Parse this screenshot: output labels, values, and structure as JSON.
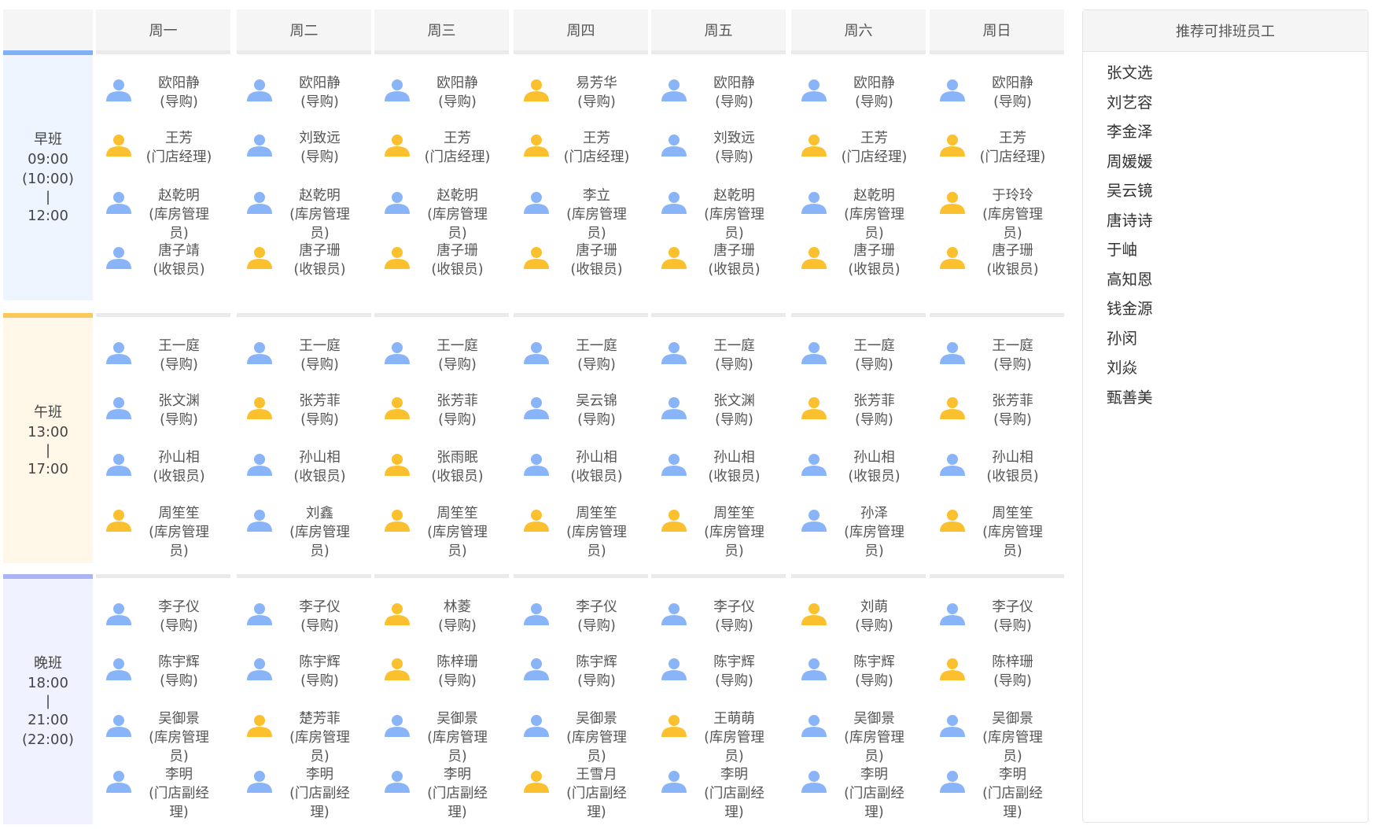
{
  "days": [
    "周一",
    "周二",
    "周三",
    "周四",
    "周五",
    "周六",
    "周日"
  ],
  "colors": {
    "blue": "#8ab4f8",
    "yellow": "#fbc02d",
    "morning_bg": "#eef5ff",
    "noon_bg": "#fff8e8",
    "evening_bg": "#f0f3ff",
    "morning_accent": "#7fb0f5",
    "noon_accent": "#fbc85a",
    "evening_accent": "#aab4f5"
  },
  "shifts": [
    {
      "name": "早班",
      "time_lines": [
        "09:00",
        "(10:00)",
        "|",
        "12:00"
      ],
      "days": [
        [
          {
            "color": "blue",
            "icon": "person-icon",
            "lines": [
              "欧阳静",
              "(导购)"
            ]
          },
          {
            "color": "yellow",
            "icon": "person-icon",
            "lines": [
              "王芳",
              "(门店经理)"
            ]
          },
          {
            "color": "blue",
            "icon": "person-icon",
            "lines": [
              "赵乾明",
              "(库房管理",
              "员)"
            ]
          },
          {
            "color": "blue",
            "icon": "person-icon",
            "lines": [
              "唐子靖",
              "(收银员)"
            ]
          }
        ],
        [
          {
            "color": "blue",
            "icon": "person-icon",
            "lines": [
              "欧阳静",
              "(导购)"
            ]
          },
          {
            "color": "blue",
            "icon": "person-icon",
            "lines": [
              "刘致远",
              "(导购)"
            ]
          },
          {
            "color": "blue",
            "icon": "person-icon",
            "lines": [
              "赵乾明",
              "(库房管理",
              "员)"
            ]
          },
          {
            "color": "yellow",
            "icon": "person-icon",
            "lines": [
              "唐子珊",
              "(收银员)"
            ]
          }
        ],
        [
          {
            "color": "blue",
            "icon": "person-icon",
            "lines": [
              "欧阳静",
              "(导购)"
            ]
          },
          {
            "color": "yellow",
            "icon": "person-icon",
            "lines": [
              "王芳",
              "(门店经理)"
            ]
          },
          {
            "color": "blue",
            "icon": "person-icon",
            "lines": [
              "赵乾明",
              "(库房管理",
              "员)"
            ]
          },
          {
            "color": "yellow",
            "icon": "person-icon",
            "lines": [
              "唐子珊",
              "(收银员)"
            ]
          }
        ],
        [
          {
            "color": "yellow",
            "icon": "person-icon",
            "lines": [
              "易芳华",
              "(导购)"
            ]
          },
          {
            "color": "yellow",
            "icon": "person-icon",
            "lines": [
              "王芳",
              "(门店经理)"
            ]
          },
          {
            "color": "blue",
            "icon": "person-icon",
            "lines": [
              "李立",
              "(库房管理",
              "员)"
            ]
          },
          {
            "color": "yellow",
            "icon": "person-icon",
            "lines": [
              "唐子珊",
              "(收银员)"
            ]
          }
        ],
        [
          {
            "color": "blue",
            "icon": "person-icon",
            "lines": [
              "欧阳静",
              "(导购)"
            ]
          },
          {
            "color": "blue",
            "icon": "person-icon",
            "lines": [
              "刘致远",
              "(导购)"
            ]
          },
          {
            "color": "blue",
            "icon": "person-icon",
            "lines": [
              "赵乾明",
              "(库房管理",
              "员)"
            ]
          },
          {
            "color": "yellow",
            "icon": "person-icon",
            "lines": [
              "唐子珊",
              "(收银员)"
            ]
          }
        ],
        [
          {
            "color": "blue",
            "icon": "person-icon",
            "lines": [
              "欧阳静",
              "(导购)"
            ]
          },
          {
            "color": "yellow",
            "icon": "person-icon",
            "lines": [
              "王芳",
              "(门店经理)"
            ]
          },
          {
            "color": "blue",
            "icon": "person-icon",
            "lines": [
              "赵乾明",
              "(库房管理",
              "员)"
            ]
          },
          {
            "color": "yellow",
            "icon": "person-icon",
            "lines": [
              "唐子珊",
              "(收银员)"
            ]
          }
        ],
        [
          {
            "color": "blue",
            "icon": "person-icon",
            "lines": [
              "欧阳静",
              "(导购)"
            ]
          },
          {
            "color": "yellow",
            "icon": "person-icon",
            "lines": [
              "王芳",
              "(门店经理)"
            ]
          },
          {
            "color": "yellow",
            "icon": "person-icon",
            "lines": [
              "于玲玲",
              "(库房管理",
              "员)"
            ]
          },
          {
            "color": "yellow",
            "icon": "person-icon",
            "lines": [
              "唐子珊",
              "(收银员)"
            ]
          }
        ]
      ]
    },
    {
      "name": "午班",
      "time_lines": [
        "13:00",
        "|",
        "17:00"
      ],
      "days": [
        [
          {
            "color": "blue",
            "icon": "person-icon",
            "lines": [
              "王一庭",
              "(导购)"
            ]
          },
          {
            "color": "blue",
            "icon": "person-icon",
            "lines": [
              "张文渊",
              "(导购)"
            ]
          },
          {
            "color": "blue",
            "icon": "person-icon",
            "lines": [
              "孙山相",
              "(收银员)"
            ]
          },
          {
            "color": "yellow",
            "icon": "person-icon",
            "lines": [
              "周笙笙",
              "(库房管理",
              "员)"
            ]
          }
        ],
        [
          {
            "color": "blue",
            "icon": "person-icon",
            "lines": [
              "王一庭",
              "(导购)"
            ]
          },
          {
            "color": "yellow",
            "icon": "person-icon",
            "lines": [
              "张芳菲",
              "(导购)"
            ]
          },
          {
            "color": "blue",
            "icon": "person-icon",
            "lines": [
              "孙山相",
              "(收银员)"
            ]
          },
          {
            "color": "blue",
            "icon": "person-icon",
            "lines": [
              "刘鑫",
              "(库房管理",
              "员)"
            ]
          }
        ],
        [
          {
            "color": "blue",
            "icon": "person-icon",
            "lines": [
              "王一庭",
              "(导购)"
            ]
          },
          {
            "color": "yellow",
            "icon": "person-icon",
            "lines": [
              "张芳菲",
              "(导购)"
            ]
          },
          {
            "color": "yellow",
            "icon": "person-icon",
            "lines": [
              "张雨眠",
              "(收银员)"
            ]
          },
          {
            "color": "yellow",
            "icon": "person-icon",
            "lines": [
              "周笙笙",
              "(库房管理",
              "员)"
            ]
          }
        ],
        [
          {
            "color": "blue",
            "icon": "person-icon",
            "lines": [
              "王一庭",
              "(导购)"
            ]
          },
          {
            "color": "blue",
            "icon": "person-icon",
            "lines": [
              "吴云锦",
              "(导购)"
            ]
          },
          {
            "color": "blue",
            "icon": "person-icon",
            "lines": [
              "孙山相",
              "(收银员)"
            ]
          },
          {
            "color": "yellow",
            "icon": "person-icon",
            "lines": [
              "周笙笙",
              "(库房管理",
              "员)"
            ]
          }
        ],
        [
          {
            "color": "blue",
            "icon": "person-icon",
            "lines": [
              "王一庭",
              "(导购)"
            ]
          },
          {
            "color": "blue",
            "icon": "person-icon",
            "lines": [
              "张文渊",
              "(导购)"
            ]
          },
          {
            "color": "blue",
            "icon": "person-icon",
            "lines": [
              "孙山相",
              "(收银员)"
            ]
          },
          {
            "color": "yellow",
            "icon": "person-icon",
            "lines": [
              "周笙笙",
              "(库房管理",
              "员)"
            ]
          }
        ],
        [
          {
            "color": "blue",
            "icon": "person-icon",
            "lines": [
              "王一庭",
              "(导购)"
            ]
          },
          {
            "color": "yellow",
            "icon": "person-icon",
            "lines": [
              "张芳菲",
              "(导购)"
            ]
          },
          {
            "color": "blue",
            "icon": "person-icon",
            "lines": [
              "孙山相",
              "(收银员)"
            ]
          },
          {
            "color": "blue",
            "icon": "person-icon",
            "lines": [
              "孙泽",
              "(库房管理",
              "员)"
            ]
          }
        ],
        [
          {
            "color": "blue",
            "icon": "person-icon",
            "lines": [
              "王一庭",
              "(导购)"
            ]
          },
          {
            "color": "yellow",
            "icon": "person-icon",
            "lines": [
              "张芳菲",
              "(导购)"
            ]
          },
          {
            "color": "blue",
            "icon": "person-icon",
            "lines": [
              "孙山相",
              "(收银员)"
            ]
          },
          {
            "color": "yellow",
            "icon": "person-icon",
            "lines": [
              "周笙笙",
              "(库房管理",
              "员)"
            ]
          }
        ]
      ]
    },
    {
      "name": "晚班",
      "time_lines": [
        "18:00",
        "|",
        "21:00",
        "(22:00)"
      ],
      "days": [
        [
          {
            "color": "blue",
            "icon": "person-icon",
            "lines": [
              "李子仪",
              "(导购)"
            ]
          },
          {
            "color": "blue",
            "icon": "person-icon",
            "lines": [
              "陈宇辉",
              "(导购)"
            ]
          },
          {
            "color": "blue",
            "icon": "person-icon",
            "lines": [
              "吴御景",
              "(库房管理",
              "员)"
            ]
          },
          {
            "color": "blue",
            "icon": "person-icon",
            "lines": [
              "李明",
              "(门店副经",
              "理)"
            ]
          }
        ],
        [
          {
            "color": "blue",
            "icon": "person-icon",
            "lines": [
              "李子仪",
              "(导购)"
            ]
          },
          {
            "color": "blue",
            "icon": "person-icon",
            "lines": [
              "陈宇辉",
              "(导购)"
            ]
          },
          {
            "color": "yellow",
            "icon": "person-icon",
            "lines": [
              "楚芳菲",
              "(库房管理",
              "员)"
            ]
          },
          {
            "color": "blue",
            "icon": "person-icon",
            "lines": [
              "李明",
              "(门店副经",
              "理)"
            ]
          }
        ],
        [
          {
            "color": "yellow",
            "icon": "person-icon",
            "lines": [
              "林菱",
              "(导购)"
            ]
          },
          {
            "color": "yellow",
            "icon": "person-icon",
            "lines": [
              "陈梓珊",
              "(导购)"
            ]
          },
          {
            "color": "blue",
            "icon": "person-icon",
            "lines": [
              "吴御景",
              "(库房管理",
              "员)"
            ]
          },
          {
            "color": "blue",
            "icon": "person-icon",
            "lines": [
              "李明",
              "(门店副经",
              "理)"
            ]
          }
        ],
        [
          {
            "color": "blue",
            "icon": "person-icon",
            "lines": [
              "李子仪",
              "(导购)"
            ]
          },
          {
            "color": "blue",
            "icon": "person-icon",
            "lines": [
              "陈宇辉",
              "(导购)"
            ]
          },
          {
            "color": "blue",
            "icon": "person-icon",
            "lines": [
              "吴御景",
              "(库房管理",
              "员)"
            ]
          },
          {
            "color": "yellow",
            "icon": "person-icon",
            "lines": [
              "王雪月",
              "(门店副经",
              "理)"
            ]
          }
        ],
        [
          {
            "color": "blue",
            "icon": "person-icon",
            "lines": [
              "李子仪",
              "(导购)"
            ]
          },
          {
            "color": "blue",
            "icon": "person-icon",
            "lines": [
              "陈宇辉",
              "(导购)"
            ]
          },
          {
            "color": "yellow",
            "icon": "person-icon",
            "lines": [
              "王萌萌",
              "(库房管理",
              "员)"
            ]
          },
          {
            "color": "blue",
            "icon": "person-icon",
            "lines": [
              "李明",
              "(门店副经",
              "理)"
            ]
          }
        ],
        [
          {
            "color": "yellow",
            "icon": "person-icon",
            "lines": [
              "刘萌",
              "(导购)"
            ]
          },
          {
            "color": "blue",
            "icon": "person-icon",
            "lines": [
              "陈宇辉",
              "(导购)"
            ]
          },
          {
            "color": "blue",
            "icon": "person-icon",
            "lines": [
              "吴御景",
              "(库房管理",
              "员)"
            ]
          },
          {
            "color": "blue",
            "icon": "person-icon",
            "lines": [
              "李明",
              "(门店副经",
              "理)"
            ]
          }
        ],
        [
          {
            "color": "blue",
            "icon": "person-icon",
            "lines": [
              "李子仪",
              "(导购)"
            ]
          },
          {
            "color": "yellow",
            "icon": "person-icon",
            "lines": [
              "陈梓珊",
              "(导购)"
            ]
          },
          {
            "color": "blue",
            "icon": "person-icon",
            "lines": [
              "吴御景",
              "(库房管理",
              "员)"
            ]
          },
          {
            "color": "blue",
            "icon": "person-icon",
            "lines": [
              "李明",
              "(门店副经",
              "理)"
            ]
          }
        ]
      ]
    }
  ],
  "side_panel": {
    "title": "推荐可排班员工",
    "employees": [
      "张文选",
      "刘艺容",
      "李金泽",
      "周媛媛",
      "吴云镜",
      "唐诗诗",
      "于岫",
      "高知恩",
      "钱金源",
      "孙闵",
      "刘焱",
      "甄善美"
    ]
  }
}
